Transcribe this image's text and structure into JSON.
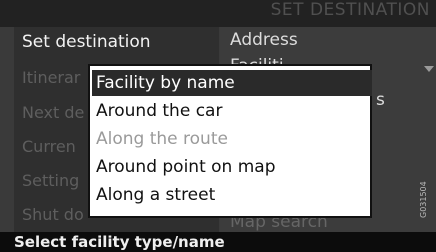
{
  "header": {
    "title": "SET DESTINATION"
  },
  "left_menu": {
    "items": [
      {
        "label": "Set destination",
        "selected": true
      },
      {
        "label": "Itinerar",
        "selected": false
      },
      {
        "label": "Next de",
        "selected": false
      },
      {
        "label": "Curren",
        "selected": false
      },
      {
        "label": "Setting",
        "selected": false
      },
      {
        "label": "Shut do",
        "selected": false
      }
    ]
  },
  "right_menu": {
    "items": [
      {
        "label": "Address"
      },
      {
        "label": "Faciliti"
      },
      {
        "label": "s"
      },
      {
        "label": "Map search"
      }
    ]
  },
  "popup": {
    "items": [
      {
        "label": "Facility by name",
        "state": "highlighted"
      },
      {
        "label": "Around the car",
        "state": "enabled"
      },
      {
        "label": "Along the route",
        "state": "disabled"
      },
      {
        "label": "Around point on map",
        "state": "enabled"
      },
      {
        "label": "Along a street",
        "state": "enabled"
      }
    ]
  },
  "status": {
    "text": "Select facility type/name"
  },
  "image_code": "G031504"
}
